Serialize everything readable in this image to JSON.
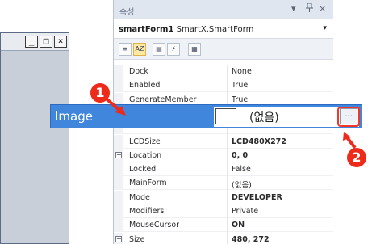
{
  "form_window": {
    "buttons": [
      "_",
      "□",
      "×"
    ]
  },
  "properties_panel": {
    "title": "속성",
    "title_controls": [
      "▾",
      "ᅟ",
      "×"
    ],
    "object_name": "smartForm1",
    "object_type": "SmartX.SmartForm",
    "toolbar_icons": [
      "categorized-icon",
      "alphabetical-icon",
      "properties-icon",
      "events-icon",
      "property-pages-icon"
    ],
    "rows": [
      {
        "name": "Dock",
        "value": "None",
        "bold": false,
        "expandable": false
      },
      {
        "name": "Enabled",
        "value": "True",
        "bold": false,
        "expandable": false
      },
      {
        "name": "GenerateMember",
        "value": "True",
        "bold": false,
        "expandable": false
      },
      {
        "name": "",
        "value": "",
        "bold": false,
        "expandable": false
      },
      {
        "name": "",
        "value": "",
        "bold": false,
        "expandable": false
      },
      {
        "name": "LCDSize",
        "value": "LCD480X272",
        "bold": true,
        "expandable": false
      },
      {
        "name": "Location",
        "value": "0, 0",
        "bold": true,
        "expandable": true
      },
      {
        "name": "Locked",
        "value": "False",
        "bold": false,
        "expandable": false
      },
      {
        "name": "MainForm",
        "value": "(없음)",
        "bold": false,
        "expandable": false
      },
      {
        "name": "Mode",
        "value": "DEVELOPER",
        "bold": true,
        "expandable": false
      },
      {
        "name": "Modifiers",
        "value": "Private",
        "bold": false,
        "expandable": false
      },
      {
        "name": "MouseCursor",
        "value": "ON",
        "bold": true,
        "expandable": false
      },
      {
        "name": "Size",
        "value": "480, 272",
        "bold": true,
        "expandable": true
      }
    ]
  },
  "highlight": {
    "label": "Image",
    "value": "(없음)",
    "ellipsis": "..."
  },
  "callouts": {
    "first": "1",
    "second": "2"
  },
  "colors": {
    "highlight": "#3f86dc",
    "callout": "#ee2a1a"
  }
}
